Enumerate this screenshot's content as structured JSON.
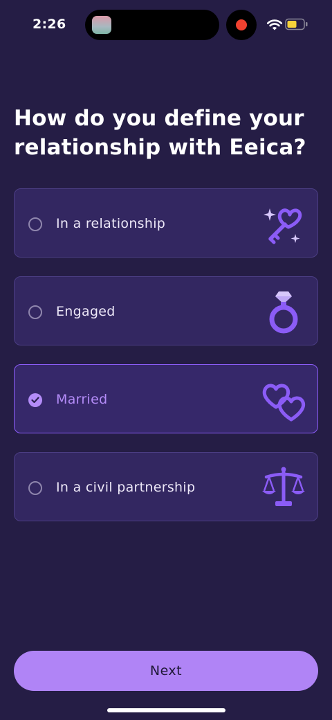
{
  "status_bar": {
    "time": "2:26"
  },
  "title": "How do you define your relationship with Eeica?",
  "options": [
    {
      "label": "In a relationship",
      "selected": false,
      "icon": "key-heart-icon"
    },
    {
      "label": "Engaged",
      "selected": false,
      "icon": "ring-icon"
    },
    {
      "label": "Married",
      "selected": true,
      "icon": "double-heart-icon"
    },
    {
      "label": "In a civil partnership",
      "selected": false,
      "icon": "scales-icon"
    }
  ],
  "next_button": {
    "label": "Next"
  },
  "colors": {
    "background": "#251d45",
    "card": "#332761",
    "card_border": "#4b3d83",
    "accent": "#b084f6",
    "selected_border": "#8b5cf6",
    "icon_purple": "#8b5cf6"
  }
}
